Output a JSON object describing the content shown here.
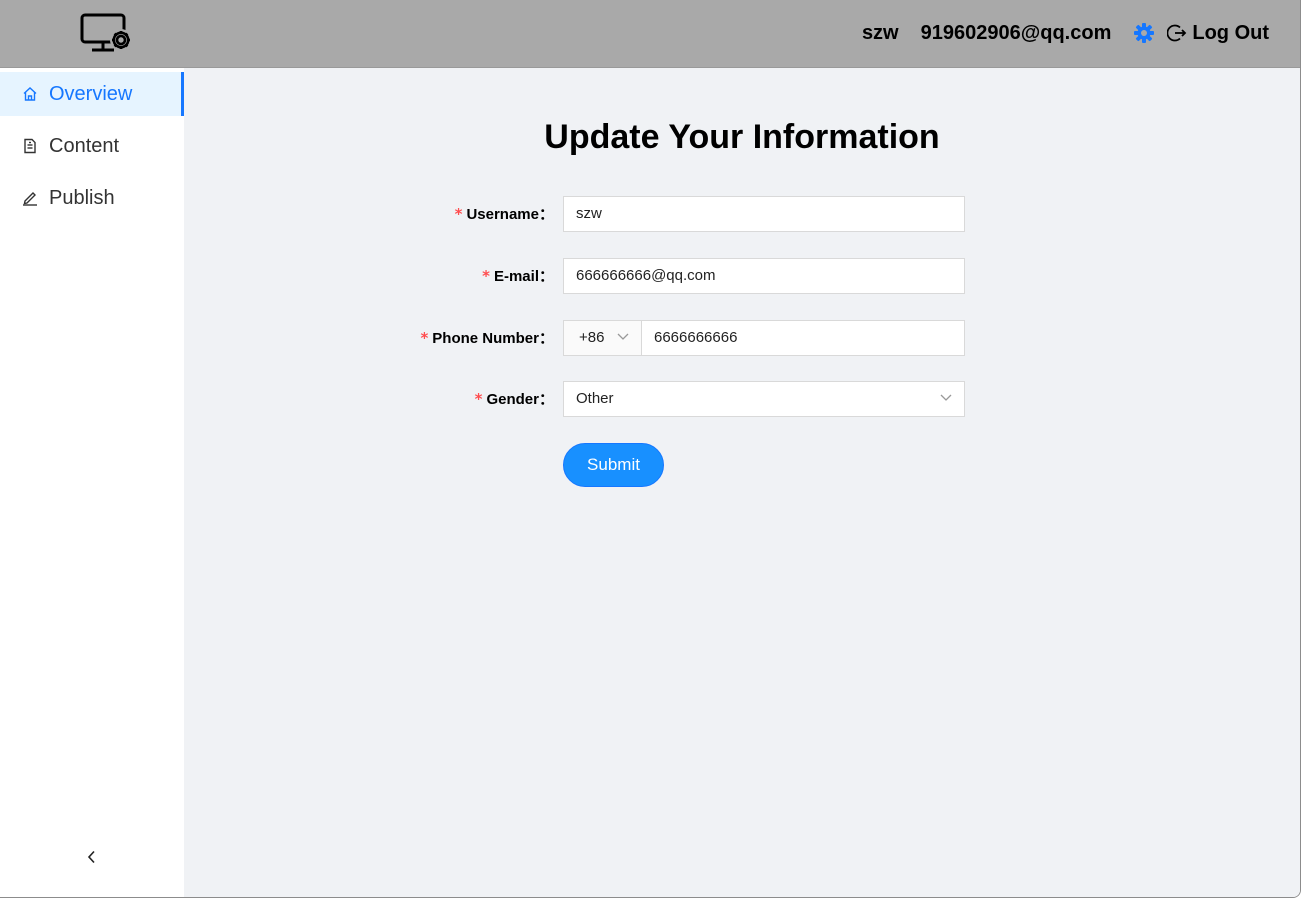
{
  "header": {
    "username": "szw",
    "email": "919602906@qq.com",
    "logout_label": "Log Out",
    "gear_color": "#1677ff"
  },
  "sidebar": {
    "items": [
      {
        "label": "Overview",
        "icon": "home-icon",
        "active": true
      },
      {
        "label": "Content",
        "icon": "document-icon",
        "active": false
      },
      {
        "label": "Publish",
        "icon": "edit-icon",
        "active": false
      }
    ],
    "collapse_icon": "chevron-left-icon"
  },
  "form": {
    "title": "Update Your Information",
    "required_mark": "*",
    "fields": {
      "username": {
        "label": "Username",
        "value": "szw"
      },
      "email": {
        "label": "E-mail",
        "value": "666666666@qq.com"
      },
      "phone": {
        "label": "Phone Number",
        "prefix": "+86",
        "value": "6666666666"
      },
      "gender": {
        "label": "Gender",
        "value": "Other"
      }
    },
    "submit_label": "Submit"
  },
  "colors": {
    "accent": "#1677ff",
    "header_bg": "#a9a9a9",
    "main_bg": "#f0f2f5",
    "required": "#ff4d4f"
  }
}
